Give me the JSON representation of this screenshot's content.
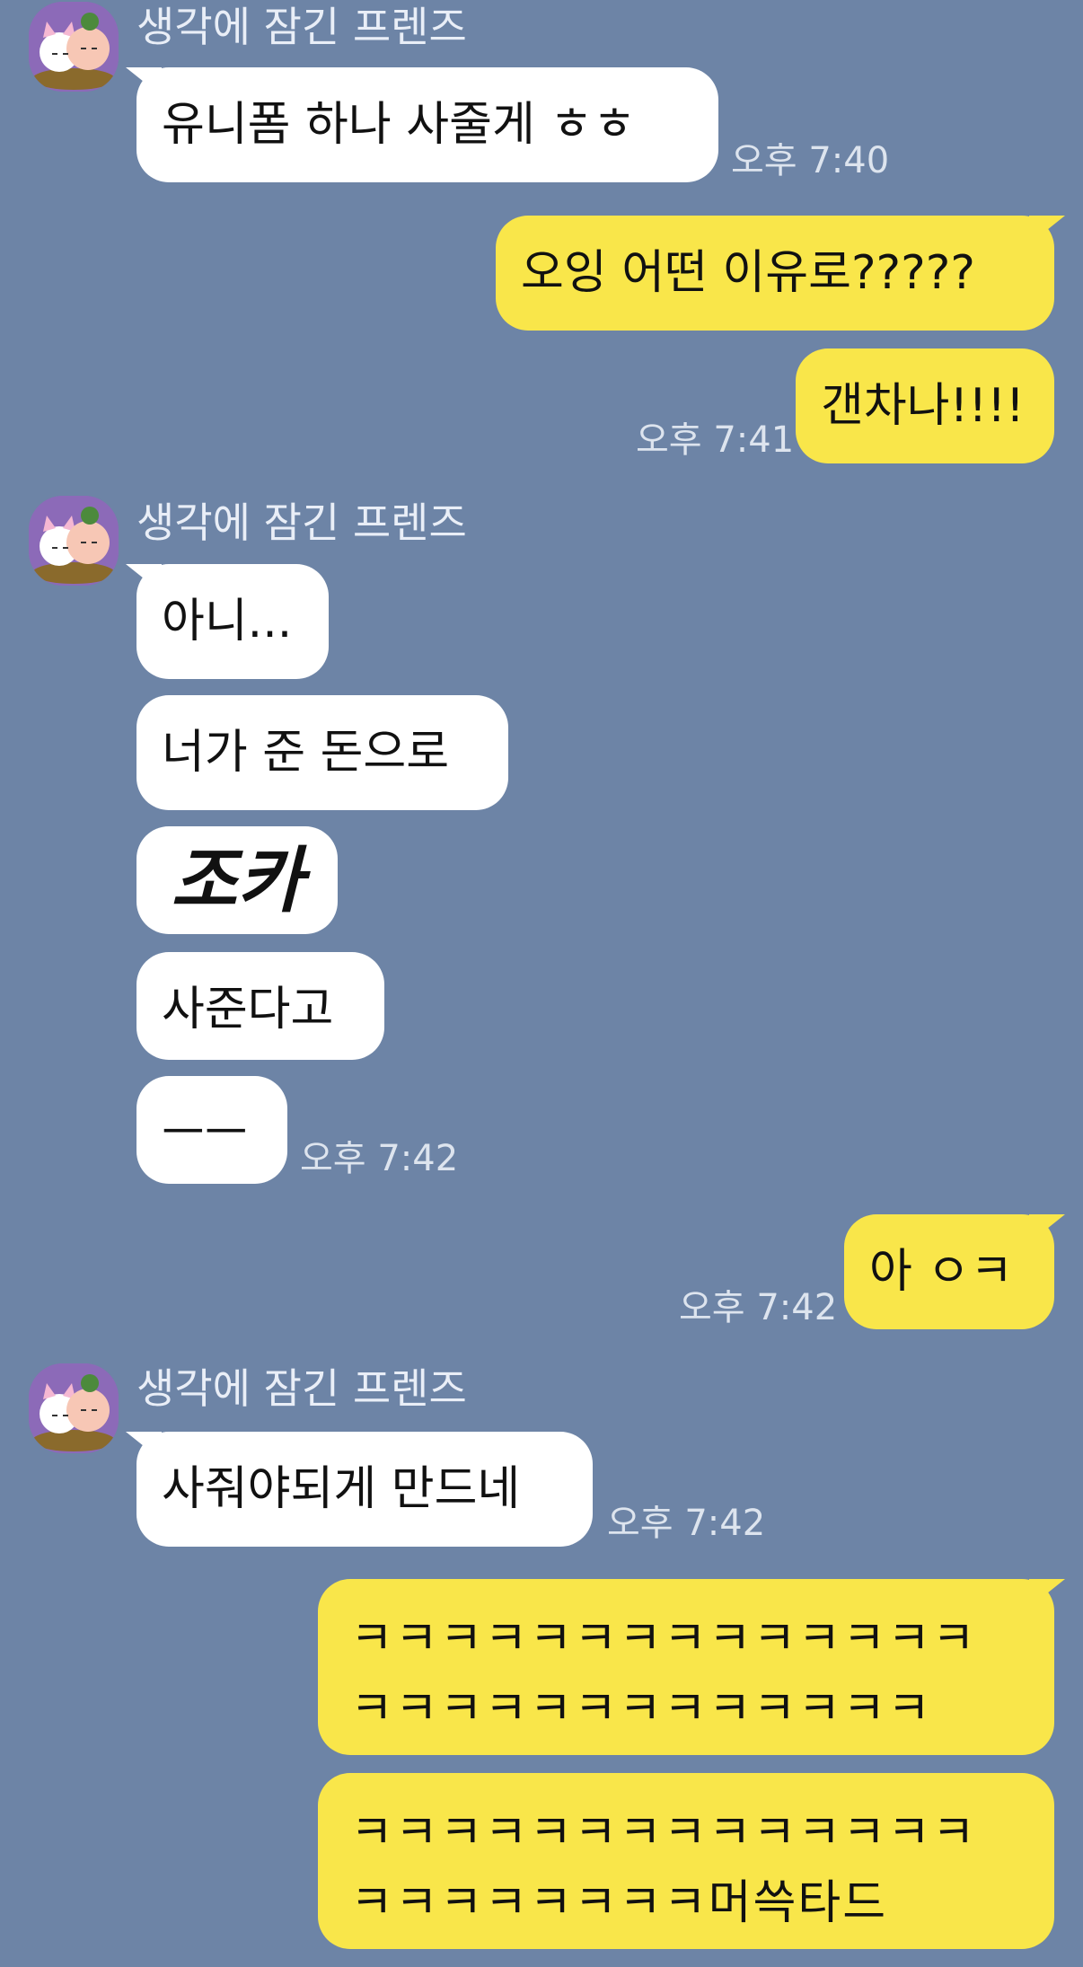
{
  "conversation": {
    "sender_name": "생각에 잠긴 프렌즈",
    "messages": {
      "m1": {
        "text": "유니폼 하나 사줄게 ㅎㅎ",
        "time": "오후 7:40"
      },
      "m2": {
        "text": "오잉 어떤 이유로?????"
      },
      "m3": {
        "text": "갠차나!!!!",
        "time": "오후 7:41"
      },
      "m4": {
        "text": "아니..."
      },
      "m5": {
        "text": "너가 준 돈으로"
      },
      "m6": {
        "text": "조카"
      },
      "m7": {
        "text": "사준다고"
      },
      "m8": {
        "text": "ㅡㅡ",
        "time": "오후 7:42"
      },
      "m9": {
        "text": "아 ㅇㅋ",
        "time": "오후 7:42"
      },
      "m10": {
        "text": "사줘야되게 만드네",
        "time": "오후 7:42"
      },
      "m11": {
        "text": "ㅋㅋㅋㅋㅋㅋㅋㅋㅋㅋㅋㅋㅋㅋ ㅋㅋㅋㅋㅋㅋㅋㅋㅋㅋㅋㅋㅋ"
      },
      "m12": {
        "text": "ㅋㅋㅋㅋㅋㅋㅋㅋㅋㅋㅋㅋㅋㅋ ㅋㅋㅋㅋㅋㅋㅋㅋ머쓱타드"
      }
    }
  },
  "colors": {
    "background": "#6d84a6",
    "incoming_bubble": "#ffffff",
    "outgoing_bubble": "#f9e64a"
  },
  "icons": {
    "avatar": "profile-avatar-icon"
  }
}
